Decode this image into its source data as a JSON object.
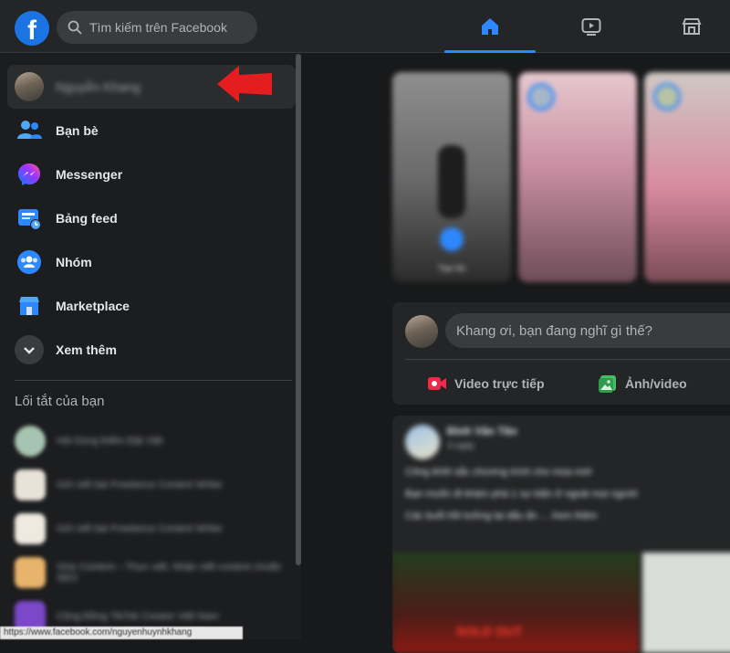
{
  "topbar": {
    "logo_letter": "f",
    "search_placeholder": "Tìm kiếm trên Facebook",
    "tabs": [
      {
        "name": "home",
        "icon": "home-icon",
        "active": true
      },
      {
        "name": "watch",
        "icon": "video-icon",
        "active": false
      },
      {
        "name": "marketplace",
        "icon": "store-icon",
        "active": false
      }
    ]
  },
  "sidebar": {
    "profile_name": "Nguyễn Khang",
    "items": [
      {
        "label": "Bạn bè",
        "icon": "friends-icon"
      },
      {
        "label": "Messenger",
        "icon": "messenger-icon"
      },
      {
        "label": "Bảng feed",
        "icon": "feed-icon"
      },
      {
        "label": "Nhóm",
        "icon": "groups-icon"
      },
      {
        "label": "Marketplace",
        "icon": "marketplace-icon"
      },
      {
        "label": "Xem thêm",
        "icon": "chevron-down-icon"
      }
    ],
    "shortcuts_title": "Lối tắt của bạn",
    "shortcuts": [
      {
        "label": "Hội Dùng Điểm Đặt Việt"
      },
      {
        "label": "Gửi viết bài Freelance Content Writer"
      },
      {
        "label": "Gửi viết bài Freelance Content Writer"
      },
      {
        "label": "Vine Content – Thực viết, Nhận viết content chuẩn SEO"
      },
      {
        "label": "Cộng Đồng TikTok Creator Việt Nam"
      }
    ]
  },
  "status_bar": {
    "url": "https://www.facebook.com/nguyenhuynhkhang"
  },
  "feed": {
    "story_label": "Tạo tin",
    "composer": {
      "placeholder": "Khang ơi, bạn đang nghĩ gì thế?",
      "actions": [
        {
          "label": "Video trực tiếp",
          "icon": "live-video-icon",
          "color": "#f02849"
        },
        {
          "label": "Ảnh/video",
          "icon": "photo-icon",
          "color": "#45bd62"
        }
      ]
    },
    "post": {
      "author": "Đinh Văn Tân",
      "time": "3 ngày",
      "body_lines": [
        "Công khởi sắc chương trình cho mùa mới",
        "Bạn muốn đi khám phá 1 sự kiện ở ngoài mọi người",
        "Các buổi hồi tưởng lại dấu ấn ... Xem thêm"
      ],
      "media_caption": "SOLD OUT"
    }
  },
  "colors": {
    "accent": "#2d88ff",
    "arrow": "#e41e1e"
  }
}
